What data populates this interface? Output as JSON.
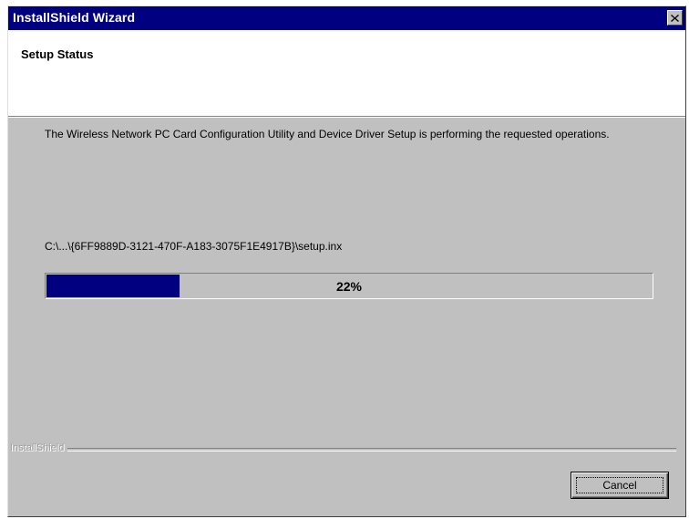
{
  "window": {
    "title": "InstallShield Wizard",
    "close_icon": "close-icon"
  },
  "header": {
    "title": "Setup Status"
  },
  "body": {
    "description": "The Wireless Network PC Card Configuration Utility and Device Driver Setup is performing the requested operations.",
    "file_path": "C:\\...\\{6FF9889D-3121-470F-A183-3075F1E4917B}\\setup.inx"
  },
  "progress": {
    "percent": 22,
    "label": "22%"
  },
  "footer": {
    "brand": "InstallShield",
    "cancel_label": "Cancel"
  },
  "colors": {
    "titlebar": "#000080",
    "progress_fill": "#000080",
    "dialog_face": "#c0c0c0"
  }
}
